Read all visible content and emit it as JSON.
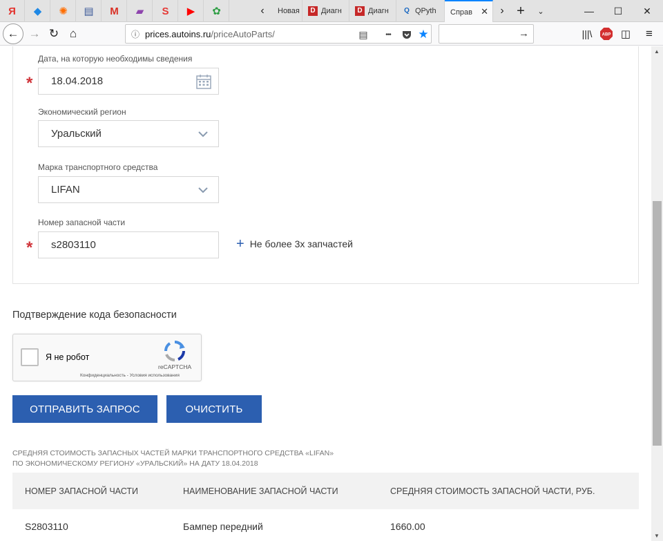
{
  "browser": {
    "pinned_tabs": [
      {
        "icon": "yandex-icon",
        "glyph": "Я",
        "color": "#e3342f"
      },
      {
        "icon": "drop-icon",
        "glyph": "◆",
        "color": "#1e88e5"
      },
      {
        "icon": "sun-icon",
        "glyph": "✺",
        "color": "#ff6d00"
      },
      {
        "icon": "monitor-icon",
        "glyph": "▤",
        "color": "#3b5998"
      },
      {
        "icon": "gmail-icon",
        "glyph": "M",
        "color": "#d93025"
      },
      {
        "icon": "app-icon",
        "glyph": "▰",
        "color": "#8e44ad"
      },
      {
        "icon": "s-audio-icon",
        "glyph": "S",
        "color": "#e53935"
      },
      {
        "icon": "youtube-icon",
        "glyph": "▶",
        "color": "#ff0000"
      },
      {
        "icon": "frog-icon",
        "glyph": "✿",
        "color": "#2e9e44"
      }
    ],
    "tabs": [
      {
        "label": "Новая",
        "icon_letter": "",
        "icon_color": "#777777"
      },
      {
        "label": "Диагн",
        "icon_letter": "D",
        "icon_color": "#c62828"
      },
      {
        "label": "Диагн",
        "icon_letter": "D",
        "icon_color": "#c62828"
      },
      {
        "label": "QPyth",
        "icon_letter": "Q",
        "icon_color": "#1565c0"
      },
      {
        "label": "Справ",
        "icon_letter": "",
        "icon_color": "#2c5fb0",
        "active": true
      }
    ],
    "url_host": "prices.autoins.ru",
    "url_path": "/priceAutoParts/",
    "url_scheme_hidden": "",
    "new_tab_symbol": "+",
    "reader_symbol": "▤",
    "more_symbol": "•••"
  },
  "form": {
    "date_label": "Дата, на которую необходимы сведения",
    "date_value": "18.04.2018",
    "region_label": "Экономический регион",
    "region_value": "Уральский",
    "brand_label": "Марка транспортного средства",
    "brand_value": "LIFAN",
    "part_label": "Номер запасной части",
    "part_value": "s2803110",
    "add_part_label": "Не более 3х запчастей",
    "required_mark": "*"
  },
  "security": {
    "title": "Подтверждение кода безопасности",
    "captcha_label": "Я не робот",
    "captcha_brand": "reCAPTCHA",
    "captcha_terms": "Конфиденциальность - Условия использования"
  },
  "buttons": {
    "submit": "ОТПРАВИТЬ ЗАПРОС",
    "clear": "ОЧИСТИТЬ"
  },
  "result": {
    "caption_line1": "СРЕДНЯЯ СТОИМОСТЬ ЗАПАСНЫХ ЧАСТЕЙ МАРКИ ТРАНСПОРТНОГО СРЕДСТВА «LIFAN»",
    "caption_line2": "ПО ЭКОНОМИЧЕСКОМУ РЕГИОНУ «УРАЛЬСКИЙ» НА ДАТУ 18.04.2018",
    "columns": [
      "НОМЕР ЗАПАСНОЙ ЧАСТИ",
      "НАИМЕНОВАНИЕ ЗАПАСНОЙ ЧАСТИ",
      "СРЕДНЯЯ СТОИМОСТЬ ЗАПАСНОЙ ЧАСТИ, РУБ."
    ],
    "rows": [
      [
        "S2803110",
        "Бампер передний",
        "1660.00"
      ]
    ]
  },
  "colors": {
    "accent": "#2c5fb0",
    "required": "#d0343a",
    "firefox_active_tab": "#0a84ff"
  }
}
